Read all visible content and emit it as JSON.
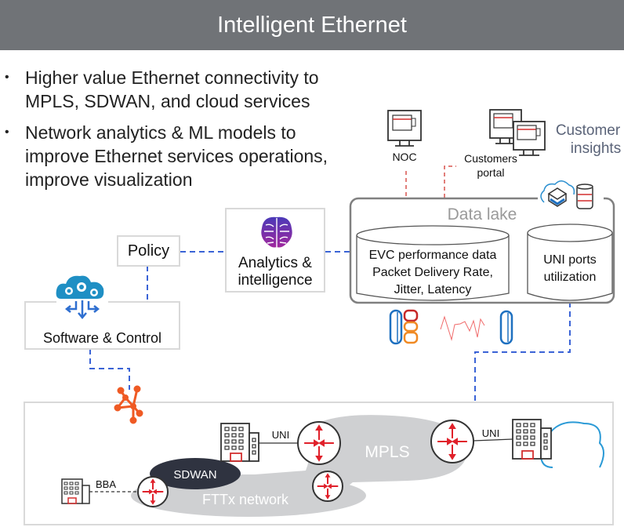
{
  "header": {
    "title": "Intelligent Ethernet"
  },
  "bullets": [
    {
      "symbol": "•",
      "text": "Higher value Ethernet connectivity to MPLS, SDWAN, and cloud services"
    },
    {
      "symbol": "•",
      "text": "Network analytics & ML models to improve Ethernet services operations, improve visualization"
    }
  ],
  "diagram": {
    "noc_label": "NOC",
    "customers_portal_label": [
      "Customers",
      "portal"
    ],
    "customer_insights_label": [
      "Customer",
      "insights"
    ],
    "data_lake_label": "Data lake",
    "evc_store": [
      "EVC performance data",
      "Packet Delivery Rate,",
      "Jitter, Latency"
    ],
    "uni_store": [
      "UNI ports",
      "utilization"
    ],
    "policy_label": "Policy",
    "analytics_label": [
      "Analytics &",
      "intelligence"
    ],
    "software_control_label": "Software & Control",
    "network": {
      "sdwan_label": "SDWAN",
      "fttx_label": "FTTx network",
      "mpls_label": "MPLS",
      "uni_left_label": "UNI",
      "uni_right_label": "UNI",
      "bba_label": "BBA"
    },
    "colors": {
      "header_bg": "#707377",
      "dashed_blue": "#3a63d6",
      "dashed_red": "#d9534f",
      "router_arrow": "#e0202a",
      "network_cloud": "#cfd0d2",
      "sdwan_fill": "#2f3340",
      "brain": "#6b2fa8",
      "gear_cloud": "#1f8fc4",
      "hub": "#ef5a24",
      "customer_cloud": "#2a9ad6"
    }
  }
}
